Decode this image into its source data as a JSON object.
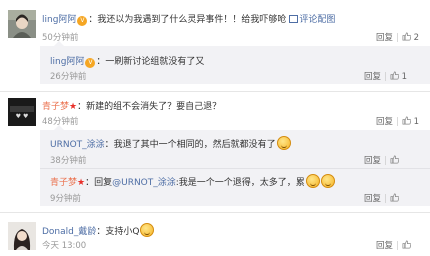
{
  "comments": [
    {
      "user": "ling阿阿",
      "text": "：我还以为我遇到了什么灵异事件！！给我吓够呛",
      "pic_link": "评论配图",
      "time": "50分钟前",
      "actions": {
        "reply": "回复",
        "like_count": "2"
      },
      "replies": [
        {
          "user": "ling阿阿",
          "text": "：一刷新讨论组就没有了又",
          "time": "26分钟前",
          "actions": {
            "reply": "回复",
            "like_count": "1"
          }
        }
      ]
    },
    {
      "user": "青子梦",
      "text": "：新建的组不会消失了？要自己退？",
      "time": "48分钟前",
      "actions": {
        "reply": "回复",
        "like_count": "1"
      },
      "replies": [
        {
          "user": "URNOT_涂涂",
          "text": "：我退了其中一个相同的，然后就都没有了",
          "time": "38分钟前",
          "actions": {
            "reply": "回复",
            "like_count": ""
          }
        },
        {
          "user": "青子梦",
          "text": "：回复",
          "mention": "@URNOT_涂涂",
          "text2": ":我是一个一个退得，太多了，累",
          "time": "9分钟前",
          "actions": {
            "reply": "回复",
            "like_count": ""
          }
        }
      ]
    },
    {
      "user": "Donald_戴龄",
      "text": "：支持小Q",
      "time": "今天 13:00",
      "actions": {
        "reply": "回复",
        "like_count": ""
      }
    }
  ],
  "icons": {
    "vip": "vip-badge-icon",
    "thumb": "thumbs-up-icon",
    "emoji": "smiley-emoji-icon",
    "star": "star-badge-icon",
    "picture": "picture-icon"
  }
}
